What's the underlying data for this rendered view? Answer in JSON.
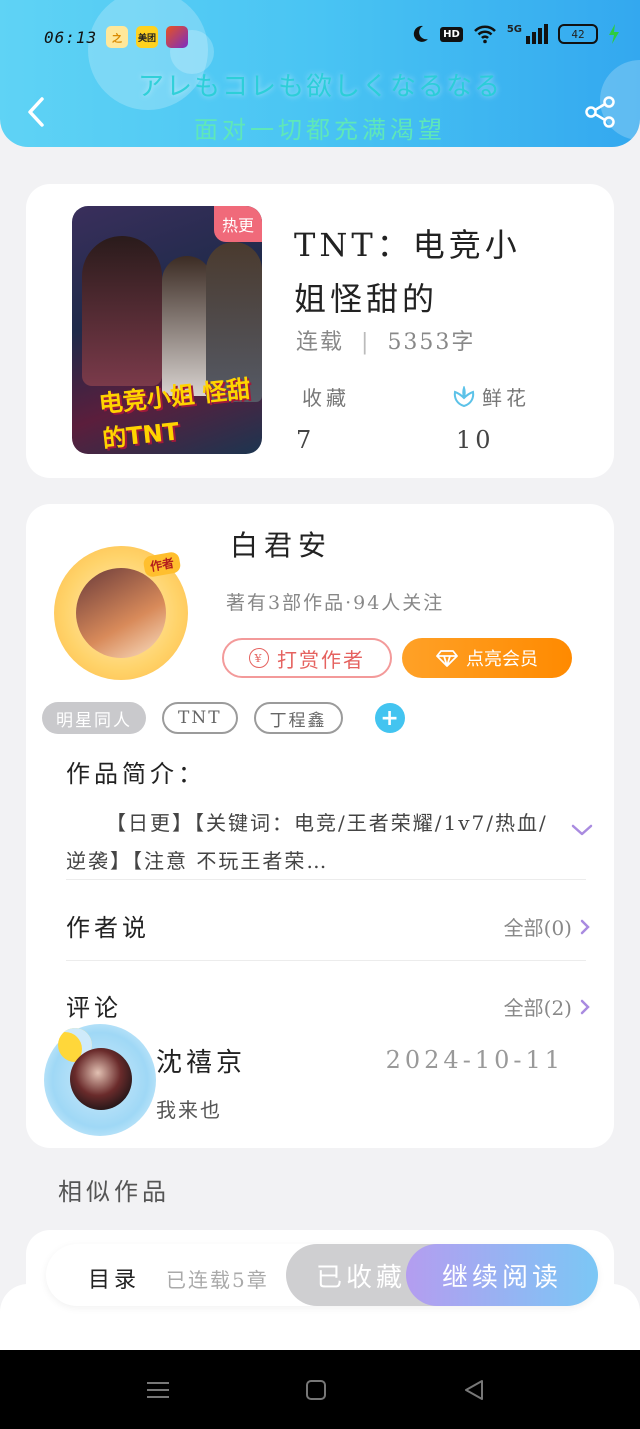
{
  "status_bar": {
    "time": "06:13",
    "app_icons": [
      "zhi-app-icon",
      "meituan-app-icon",
      "game-app-icon"
    ],
    "meituan_label": "美团",
    "zhi_label": "之",
    "hd_label": "HD",
    "network_label": "5G",
    "battery": "42"
  },
  "header": {
    "banner_jp": "アレもコレも欲しくなるなる",
    "banner_cn": "面对一切都充满渴望",
    "colors": {
      "gradient_start": "#5fd3f5",
      "gradient_end": "#33a8ef"
    }
  },
  "book": {
    "hot_badge": "热更",
    "cover_art_text": "电竞小姐 怪甜的TNT",
    "title": "TNT：电竞小姐怪甜的",
    "status": "连载",
    "separator": "|",
    "word_count": "5353字",
    "favorites_label": "收藏",
    "favorites_value": "7",
    "flowers_label": "鲜花",
    "flowers_value": "10"
  },
  "author": {
    "badge": "作者",
    "name": "白君安",
    "summary": "著有3部作品·94人关注",
    "tip_button": "打赏作者",
    "tip_symbol": "¥",
    "vip_button": "点亮会员",
    "tags": [
      "明星同人",
      "TNT",
      "丁程鑫"
    ],
    "add_tag": "+"
  },
  "intro": {
    "heading": "作品简介：",
    "text": "【日更】【关键词：电竞/王者荣耀/1v7/热血/逆袭】【注意 不玩王者荣…"
  },
  "author_says": {
    "heading": "作者说",
    "view_all": "全部(0)"
  },
  "comments": {
    "heading": "评论",
    "view_all": "全部(2)",
    "items": [
      {
        "user": "沈禧京",
        "date": "2024-10-11",
        "text": "我来也"
      }
    ]
  },
  "similar": {
    "heading": "相似作品"
  },
  "bottom_bar": {
    "toc_label": "目录",
    "toc_count": "已连载5章",
    "collected_label": "已收藏",
    "continue_label": "继续阅读"
  }
}
